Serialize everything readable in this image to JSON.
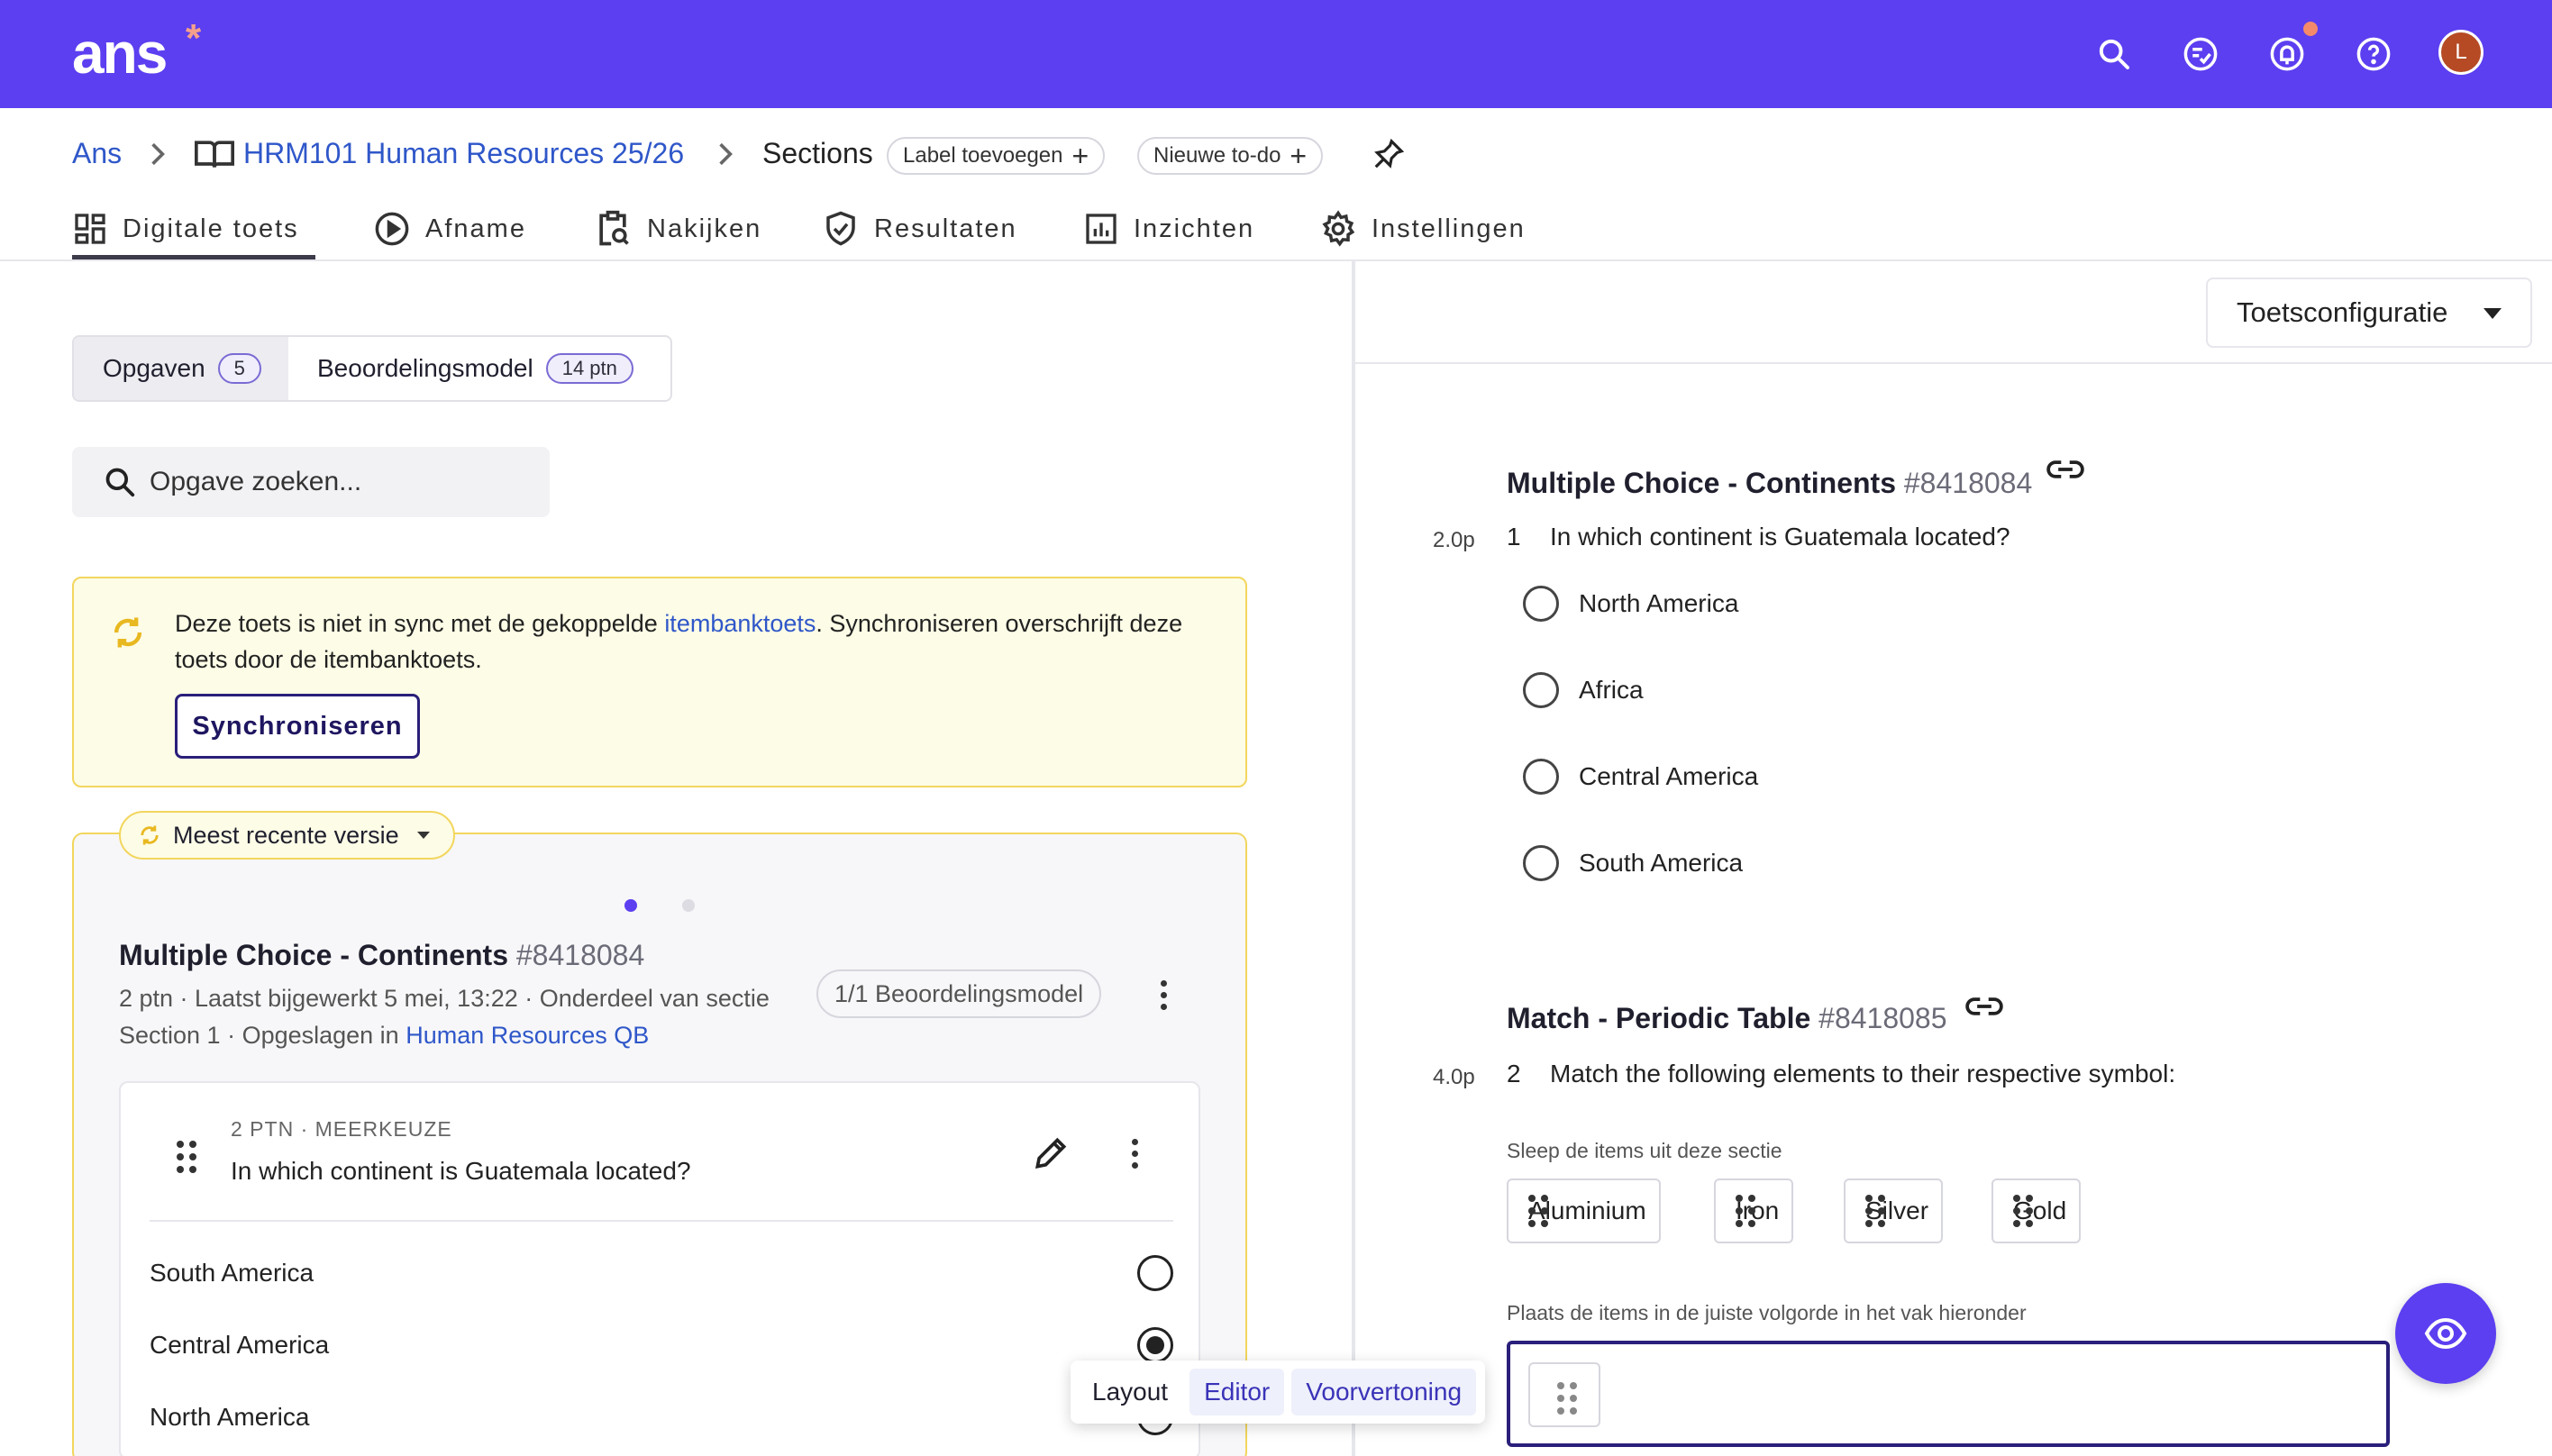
{
  "header": {
    "logo": "ans",
    "logo_mark": "*",
    "avatar_initial": "L",
    "icons": [
      "search-icon",
      "checklist-icon",
      "bell-icon",
      "help-icon"
    ]
  },
  "breadcrumb": {
    "root": "Ans",
    "course": "HRM101 Human Resources 25/26",
    "current": "Sections",
    "label_chip": "Label toevoegen",
    "todo_chip": "Nieuwe to-do"
  },
  "tabs": [
    {
      "label": "Digitale toets",
      "icon": "grid-icon"
    },
    {
      "label": "Afname",
      "icon": "play-icon"
    },
    {
      "label": "Nakijken",
      "icon": "clipboard-search-icon"
    },
    {
      "label": "Resultaten",
      "icon": "shield-check-icon"
    },
    {
      "label": "Inzichten",
      "icon": "bar-chart-icon"
    },
    {
      "label": "Instellingen",
      "icon": "gear-icon"
    }
  ],
  "left": {
    "segment": {
      "opgaven_label": "Opgaven",
      "opgaven_count": "5",
      "model_label": "Beoordelingsmodel",
      "model_count": "14 ptn"
    },
    "search_placeholder": "Opgave zoeken...",
    "sync": {
      "text_before": "Deze toets is niet in sync met de gekoppelde ",
      "link": "itembanktoets",
      "text_after": ". Synchroniseren overschrijft deze toets door de itembanktoets.",
      "button": "Synchroniseren"
    },
    "version_chip": "Meest recente versie",
    "question": {
      "title": "Multiple Choice - Continents",
      "id": "#8418084",
      "meta_line1": "2 ptn · Laatst bijgewerkt 5 mei, 13:22 · Onderdeel van sectie",
      "meta_line2_before": "Section 1 · Opgeslagen in ",
      "meta_link": "Human Resources QB",
      "model_chip": "1/1 Beoordelingsmodel",
      "sub": "2 PTN · MEERKEUZE",
      "text": "In which continent is Guatemala located?",
      "answers": [
        {
          "label": "South America",
          "selected": false
        },
        {
          "label": "Central America",
          "selected": true
        },
        {
          "label": "North America",
          "selected": false
        }
      ]
    },
    "layout_popover": {
      "label": "Layout",
      "editor": "Editor",
      "preview": "Voorvertoning"
    }
  },
  "right": {
    "config_button": "Toetsconfiguratie",
    "q1": {
      "title": "Multiple Choice - Continents",
      "id": "#8418084",
      "points": "2.0p",
      "number": "1",
      "text": "In which continent is Guatemala located?",
      "options": [
        "North America",
        "Africa",
        "Central America",
        "South America"
      ]
    },
    "q2": {
      "title": "Match - Periodic Table",
      "id": "#8418085",
      "points": "4.0p",
      "number": "2",
      "text": "Match the following elements to their respective symbol:",
      "drag_hint": "Sleep de items uit deze sectie",
      "items": [
        "Aluminium",
        "Iron",
        "Silver",
        "Gold"
      ],
      "drop_hint": "Plaats de items in de juiste volgorde in het vak hieronder"
    }
  },
  "colors": {
    "brand": "#5b3ff0",
    "link": "#2f57c9",
    "warning_bg": "#fdfce6",
    "warning_border": "#f2d65e"
  }
}
